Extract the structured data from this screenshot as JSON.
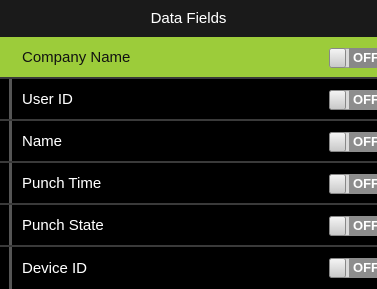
{
  "title": "Data Fields",
  "items": [
    {
      "label": "Company Name",
      "state": "OFF",
      "selected": true
    },
    {
      "label": "User ID",
      "state": "OFF",
      "selected": false
    },
    {
      "label": "Name",
      "state": "OFF",
      "selected": false
    },
    {
      "label": "Punch Time",
      "state": "OFF",
      "selected": false
    },
    {
      "label": "Punch State",
      "state": "OFF",
      "selected": false
    },
    {
      "label": "Device ID",
      "state": "OFF",
      "selected": false
    }
  ],
  "colors": {
    "highlight": "#9ccc3a",
    "background": "#000000",
    "title_bar": "#1a1a1a"
  }
}
